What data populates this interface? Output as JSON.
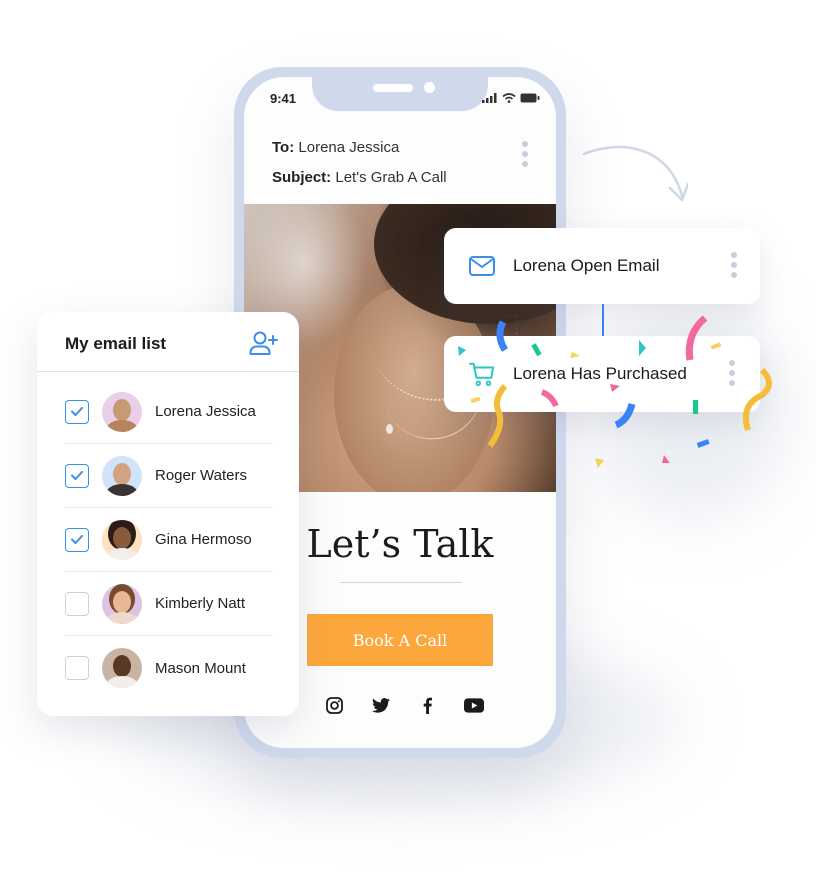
{
  "phone": {
    "status_time": "9:41",
    "email": {
      "to_label": "To:",
      "to_value": "Lorena Jessica",
      "subject_label": "Subject:",
      "subject_value": "Let's Grab A Call"
    },
    "headline": "Let’s Talk",
    "cta_label": "Book A Call",
    "socials": [
      "instagram-icon",
      "twitter-icon",
      "facebook-icon",
      "youtube-icon"
    ]
  },
  "email_list": {
    "title": "My email list",
    "add_icon": "user-plus-icon",
    "contacts": [
      {
        "name": "Lorena Jessica",
        "checked": true
      },
      {
        "name": "Roger Waters",
        "checked": true
      },
      {
        "name": "Gina Hermoso",
        "checked": true
      },
      {
        "name": "Kimberly Natt",
        "checked": false
      },
      {
        "name": "Mason Mount",
        "checked": false
      }
    ]
  },
  "notifications": [
    {
      "icon": "envelope-icon",
      "label": "Lorena Open Email"
    },
    {
      "icon": "cart-icon",
      "label": "Lorena Has Purchased"
    }
  ],
  "colors": {
    "accent_blue": "#3b8df0",
    "cta_orange": "#fca73c",
    "phone_frame": "#d0d9ec",
    "cart_teal": "#2dc7c7"
  }
}
